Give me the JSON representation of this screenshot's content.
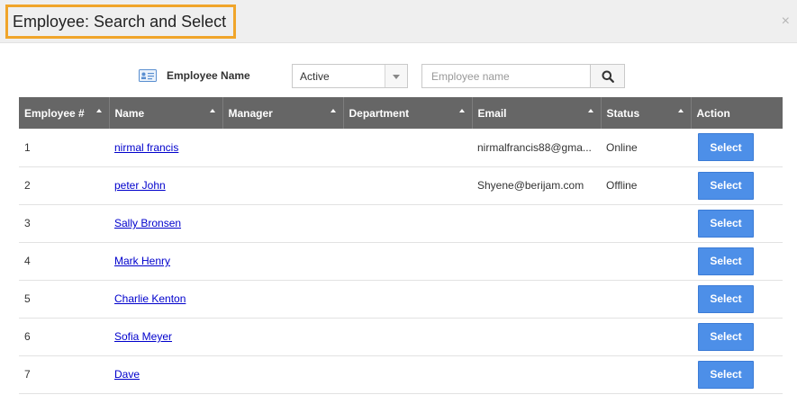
{
  "dialog": {
    "title": "Employee: Search and Select",
    "close_glyph": "×"
  },
  "filter": {
    "label": "Employee Name",
    "label_icon": "id-card-icon",
    "status_select": {
      "value": "Active"
    },
    "search": {
      "placeholder": "Employee name",
      "value": ""
    },
    "search_icon": "search-icon"
  },
  "table": {
    "columns": [
      "Employee #",
      "Name",
      "Manager",
      "Department",
      "Email",
      "Status",
      "Action"
    ],
    "rows": [
      {
        "number": "1",
        "name": "nirmal francis",
        "manager": "",
        "department": "",
        "email": "nirmalfrancis88@gma...",
        "status": "Online",
        "action": "Select"
      },
      {
        "number": "2",
        "name": "peter John",
        "manager": "",
        "department": "",
        "email": "Shyene@berijam.com",
        "status": "Offline",
        "action": "Select"
      },
      {
        "number": "3",
        "name": "Sally Bronsen",
        "manager": "",
        "department": "",
        "email": "",
        "status": "",
        "action": "Select"
      },
      {
        "number": "4",
        "name": "Mark Henry",
        "manager": "",
        "department": "",
        "email": "",
        "status": "",
        "action": "Select"
      },
      {
        "number": "5",
        "name": "Charlie Kenton",
        "manager": "",
        "department": "",
        "email": "",
        "status": "",
        "action": "Select"
      },
      {
        "number": "6",
        "name": "Sofia Meyer",
        "manager": "",
        "department": "",
        "email": "",
        "status": "",
        "action": "Select"
      },
      {
        "number": "7",
        "name": "Dave",
        "manager": "",
        "department": "",
        "email": "",
        "status": "",
        "action": "Select"
      }
    ]
  },
  "colors": {
    "title_highlight": "#f0a52a",
    "header_bg": "#666666",
    "select_button": "#4d8fe8",
    "link": "#0000cc"
  }
}
